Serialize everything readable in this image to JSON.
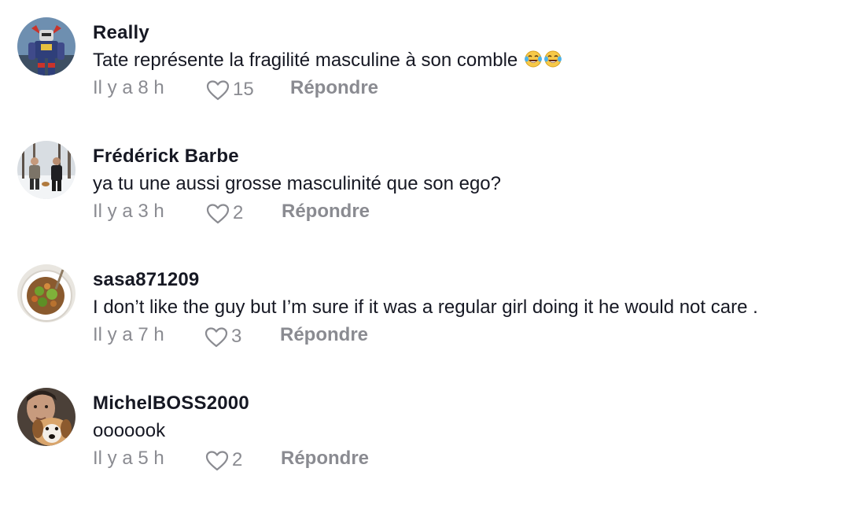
{
  "colors": {
    "username": "#161823",
    "text": "#161823",
    "meta": "#8a8b91"
  },
  "comments": [
    {
      "username": "Really",
      "text": "Tate représente la fragilité masculine à son comble",
      "emojis": [
        "face-with-tears-of-joy",
        "face-with-tears-of-joy"
      ],
      "time": "Il y a 8 h",
      "likes": "15",
      "reply_label": "Répondre",
      "avatar_icon": "robot-avatar"
    },
    {
      "username": "Frédérick Barbe",
      "text": "ya tu une aussi grosse masculinité que son ego?",
      "time": "Il y a 3 h",
      "likes": "2",
      "reply_label": "Répondre",
      "avatar_icon": "snowy-forest-people-avatar"
    },
    {
      "username": "sasa871209",
      "text": "I don’t like the guy but I’m sure if it was a regular girl doing it he would not care .",
      "time": "Il y a 7 h",
      "likes": "3",
      "reply_label": "Répondre",
      "avatar_icon": "food-bowl-avatar"
    },
    {
      "username": "MichelBOSS2000",
      "text": "ooooook",
      "time": "Il y a 5 h",
      "likes": "2",
      "reply_label": "Répondre",
      "avatar_icon": "man-with-dog-avatar"
    }
  ]
}
